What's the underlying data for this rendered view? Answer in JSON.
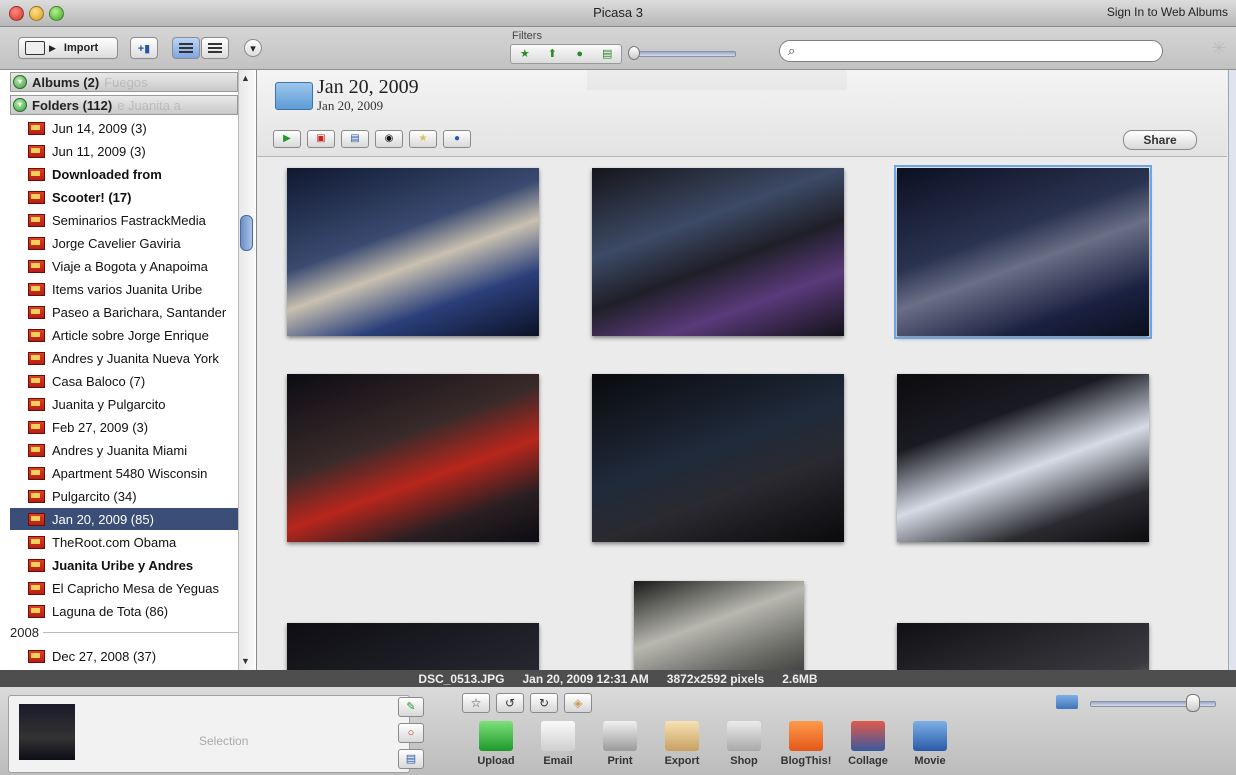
{
  "window": {
    "title": "Picasa 3",
    "signin": "Sign In to Web Albums"
  },
  "toolbar": {
    "import_label": "Import",
    "filters_label": "Filters",
    "search_placeholder": ""
  },
  "sidebar": {
    "albums": "Albums (2)",
    "albums_ghost": "Fuegos",
    "folders": "Folders (112)",
    "folders_ghost": "e Juanita a",
    "items": [
      {
        "label": "Jun 14, 2009 (3)",
        "bold": false,
        "selected": false
      },
      {
        "label": "Jun 11, 2009 (3)",
        "bold": false,
        "selected": false
      },
      {
        "label": "Downloaded from",
        "bold": true,
        "selected": false
      },
      {
        "label": "Scooter! (17)",
        "bold": true,
        "selected": false
      },
      {
        "label": "Seminarios FastrackMedia",
        "bold": false,
        "selected": false
      },
      {
        "label": "Jorge Cavelier Gaviria",
        "bold": false,
        "selected": false
      },
      {
        "label": "Viaje a Bogota y Anapoima",
        "bold": false,
        "selected": false
      },
      {
        "label": "Items varios Juanita Uribe",
        "bold": false,
        "selected": false
      },
      {
        "label": "Paseo a Barichara, Santander",
        "bold": false,
        "selected": false
      },
      {
        "label": "Article sobre Jorge Enrique",
        "bold": false,
        "selected": false
      },
      {
        "label": "Andres y Juanita Nueva York",
        "bold": false,
        "selected": false
      },
      {
        "label": "Casa Baloco (7)",
        "bold": false,
        "selected": false
      },
      {
        "label": "Juanita y Pulgarcito",
        "bold": false,
        "selected": false
      },
      {
        "label": "Feb 27, 2009 (3)",
        "bold": false,
        "selected": false
      },
      {
        "label": "Andres y Juanita Miami",
        "bold": false,
        "selected": false
      },
      {
        "label": "Apartment 5480 Wisconsin",
        "bold": false,
        "selected": false
      },
      {
        "label": "Pulgarcito (34)",
        "bold": false,
        "selected": false
      },
      {
        "label": "Jan 20, 2009 (85)",
        "bold": false,
        "selected": true
      },
      {
        "label": "TheRoot.com Obama",
        "bold": false,
        "selected": false
      },
      {
        "label": "Juanita Uribe y Andres",
        "bold": true,
        "selected": false
      },
      {
        "label": "El Capricho Mesa de Yeguas",
        "bold": false,
        "selected": false
      },
      {
        "label": "Laguna de Tota (86)",
        "bold": false,
        "selected": false
      }
    ],
    "year": "2008",
    "after_year": [
      {
        "label": "Dec 27, 2008 (37)",
        "bold": false,
        "selected": false
      }
    ]
  },
  "folder_header": {
    "title": "Jan 20, 2009",
    "date": "Jan 20, 2009",
    "share_label": "Share"
  },
  "thumbnails": [
    {
      "bg": "linear-gradient(160deg,#0f1830 0%,#3a4a70 40%,#c9c1b0 55%,#2a3f7a 75%,#0c1226 100%)"
    },
    {
      "bg": "linear-gradient(160deg,#15151a 0%,#3d4a66 35%,#1f1f28 55%,#5a3a7a 75%,#121218 100%)"
    },
    {
      "bg": "linear-gradient(160deg,#0b1022 0%,#2a3350 40%,#6a6f86 55%,#1a2140 80%,#0a0f1e 100%)",
      "selected": true
    },
    {
      "bg": "linear-gradient(160deg,#0c0c14 0%,#3a2a2a 40%,#b8261c 60%,#2a1f22 80%,#0c0c12 100%)"
    },
    {
      "bg": "linear-gradient(160deg,#0a0a0e 0%,#1f2a3a 45%,#2a2a30 65%,#0a0a0c 100%)"
    },
    {
      "bg": "linear-gradient(160deg,#0c0c0e 0%,#1a1a22 30%,#d6dbe6 55%,#2a2a30 80%,#0c0c0e 100%)"
    },
    {
      "bg": "linear-gradient(160deg,#0d0d12 0%,#2a2a34 60%,#0d0d10 100%)"
    },
    {
      "bg": "linear-gradient(160deg,#1a1a1a 0%,#b8b8b0 40%,#6a6a66 70%,#2a2a2a 100%)"
    },
    {
      "bg": "linear-gradient(160deg,#101014 0%,#3a3a40 50%,#c8c0b8 80%,#1a1a1e 100%)"
    }
  ],
  "status": {
    "filename": "DSC_0513.JPG",
    "datetime": "Jan 20, 2009 12:31 AM",
    "dimensions": "3872x2592 pixels",
    "size": "2.6MB"
  },
  "tray": {
    "selection_label": "Selection",
    "actions": [
      {
        "label": "Upload",
        "color": "linear-gradient(#7ee07a,#1f9a2a)"
      },
      {
        "label": "Email",
        "color": "linear-gradient(#fafafa,#cfcfcf)"
      },
      {
        "label": "Print",
        "color": "linear-gradient(#f0f0f0,#9a9a9a)"
      },
      {
        "label": "Export",
        "color": "linear-gradient(#f6e2b4,#c8a060)"
      },
      {
        "label": "Shop",
        "color": "linear-gradient(#ececec,#a8a8a8)"
      },
      {
        "label": "BlogThis!",
        "color": "linear-gradient(#ff9a4a,#e2581a)"
      },
      {
        "label": "Collage",
        "color": "linear-gradient(#e05a4a,#3a5aa0)"
      },
      {
        "label": "Movie",
        "color": "linear-gradient(#7ab0e6,#2a5aa8)"
      }
    ]
  }
}
